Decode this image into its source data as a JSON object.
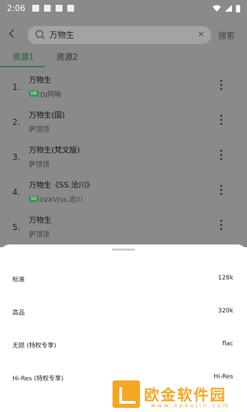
{
  "status_bar": {
    "time": "2:06"
  },
  "search": {
    "back_icon": "arrow-left-icon",
    "query": "万物生",
    "clear_icon": "close-icon",
    "submit_label": "搜索"
  },
  "tabs": [
    {
      "label": "资源1"
    },
    {
      "label": "资源2"
    }
  ],
  "songs": [
    {
      "index": "1.",
      "title": "万物生",
      "artist": "DJ阿啾",
      "badge": "HR"
    },
    {
      "index": "2.",
      "title": "万物生(国)",
      "artist": "萨顶顶"
    },
    {
      "index": "3.",
      "title": "万物生(梵文版)",
      "artist": "萨顶顶"
    },
    {
      "index": "4.",
      "title": "万物生《SS.沧川》",
      "artist": "LVXV/ss.沧川",
      "badge": "SQ"
    },
    {
      "index": "5.",
      "title": "万物生",
      "artist": "萨顶顶"
    }
  ],
  "quality_sheet": {
    "options": [
      {
        "label": "标准",
        "value": "128k"
      },
      {
        "label": "高品",
        "value": "320k"
      },
      {
        "label": "无损 (特权专享)",
        "value": "flac"
      },
      {
        "label": "Hi-Res (特权专享)",
        "value": "Hi-Res"
      }
    ]
  },
  "watermark": {
    "text": "欧金软件园",
    "url": "www.apoujin.com"
  },
  "colors": {
    "accent": "#2e7d43",
    "watermark": "#f5a623"
  }
}
